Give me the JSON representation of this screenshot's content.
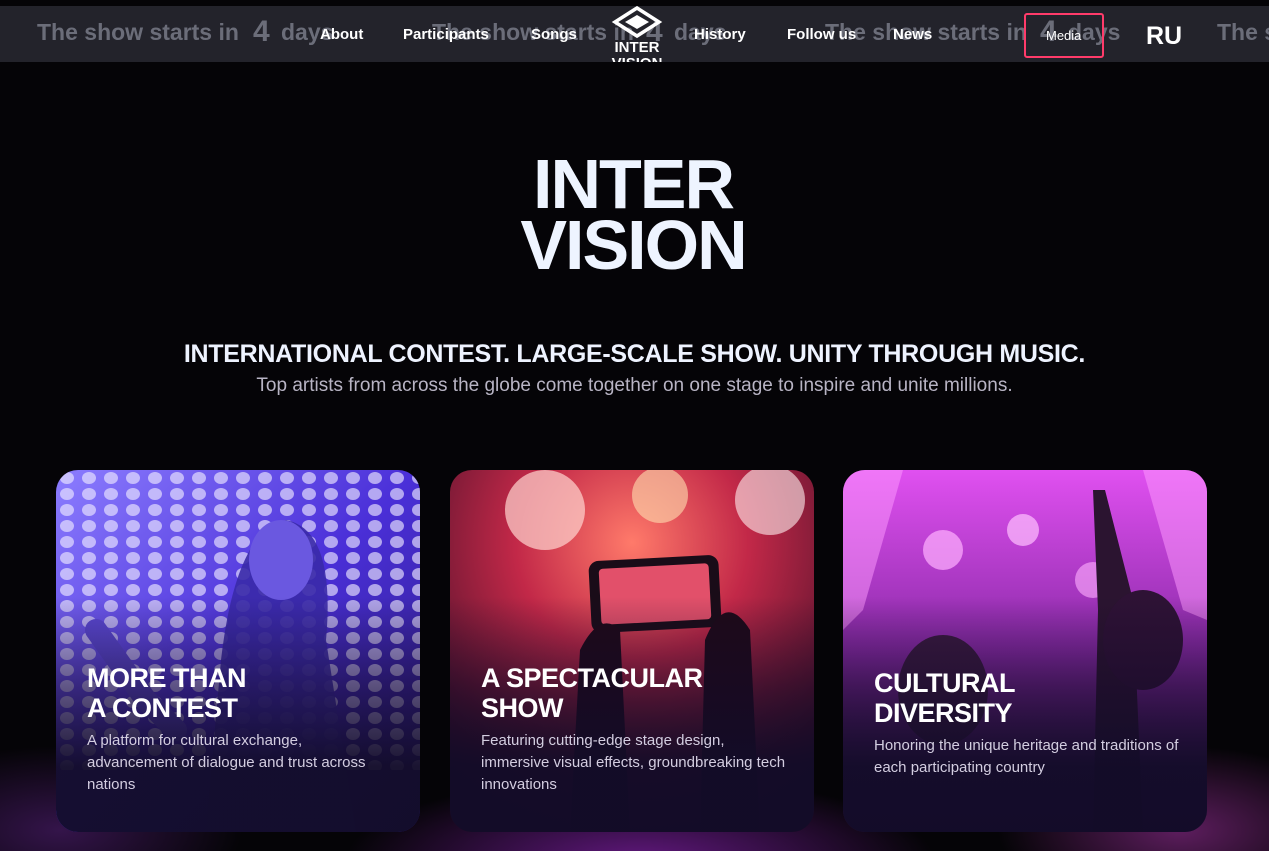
{
  "ticker": {
    "text": "The show starts in",
    "days_num": "4",
    "days_word": "days",
    "partial": "The s"
  },
  "nav": {
    "about": "About",
    "participants": "Participants",
    "songs": "Songs",
    "history": "History",
    "follow_us": "Follow us",
    "news": "News",
    "media": "Media",
    "lang": "RU"
  },
  "logo": {
    "line1": "INTER",
    "line2": "VISION"
  },
  "hero": {
    "headline": "INTERNATIONAL CONTEST. LARGE-SCALE SHOW. UNITY THROUGH MUSIC.",
    "subline": "Top artists from across the globe come together on one stage to inspire and unite millions."
  },
  "cards": [
    {
      "title": "MORE THAN\nA CONTEST",
      "desc": "A platform for cultural exchange, advancement of dialogue and trust across nations",
      "accent": "#5a3cf0"
    },
    {
      "title": "A SPECTACULAR\nSHOW",
      "desc": "Featuring cutting-edge stage design, immersive visual effects, groundbreaking tech innovations",
      "accent": "#e0304a"
    },
    {
      "title": "CULTURAL\nDIVERSITY",
      "desc": "Honoring the unique heritage and traditions of each participating country",
      "accent": "#d23cd8"
    }
  ],
  "colors": {
    "highlight_box": "#ff3b6a",
    "nav_bg": "#23232b",
    "page_bg": "#050407"
  }
}
